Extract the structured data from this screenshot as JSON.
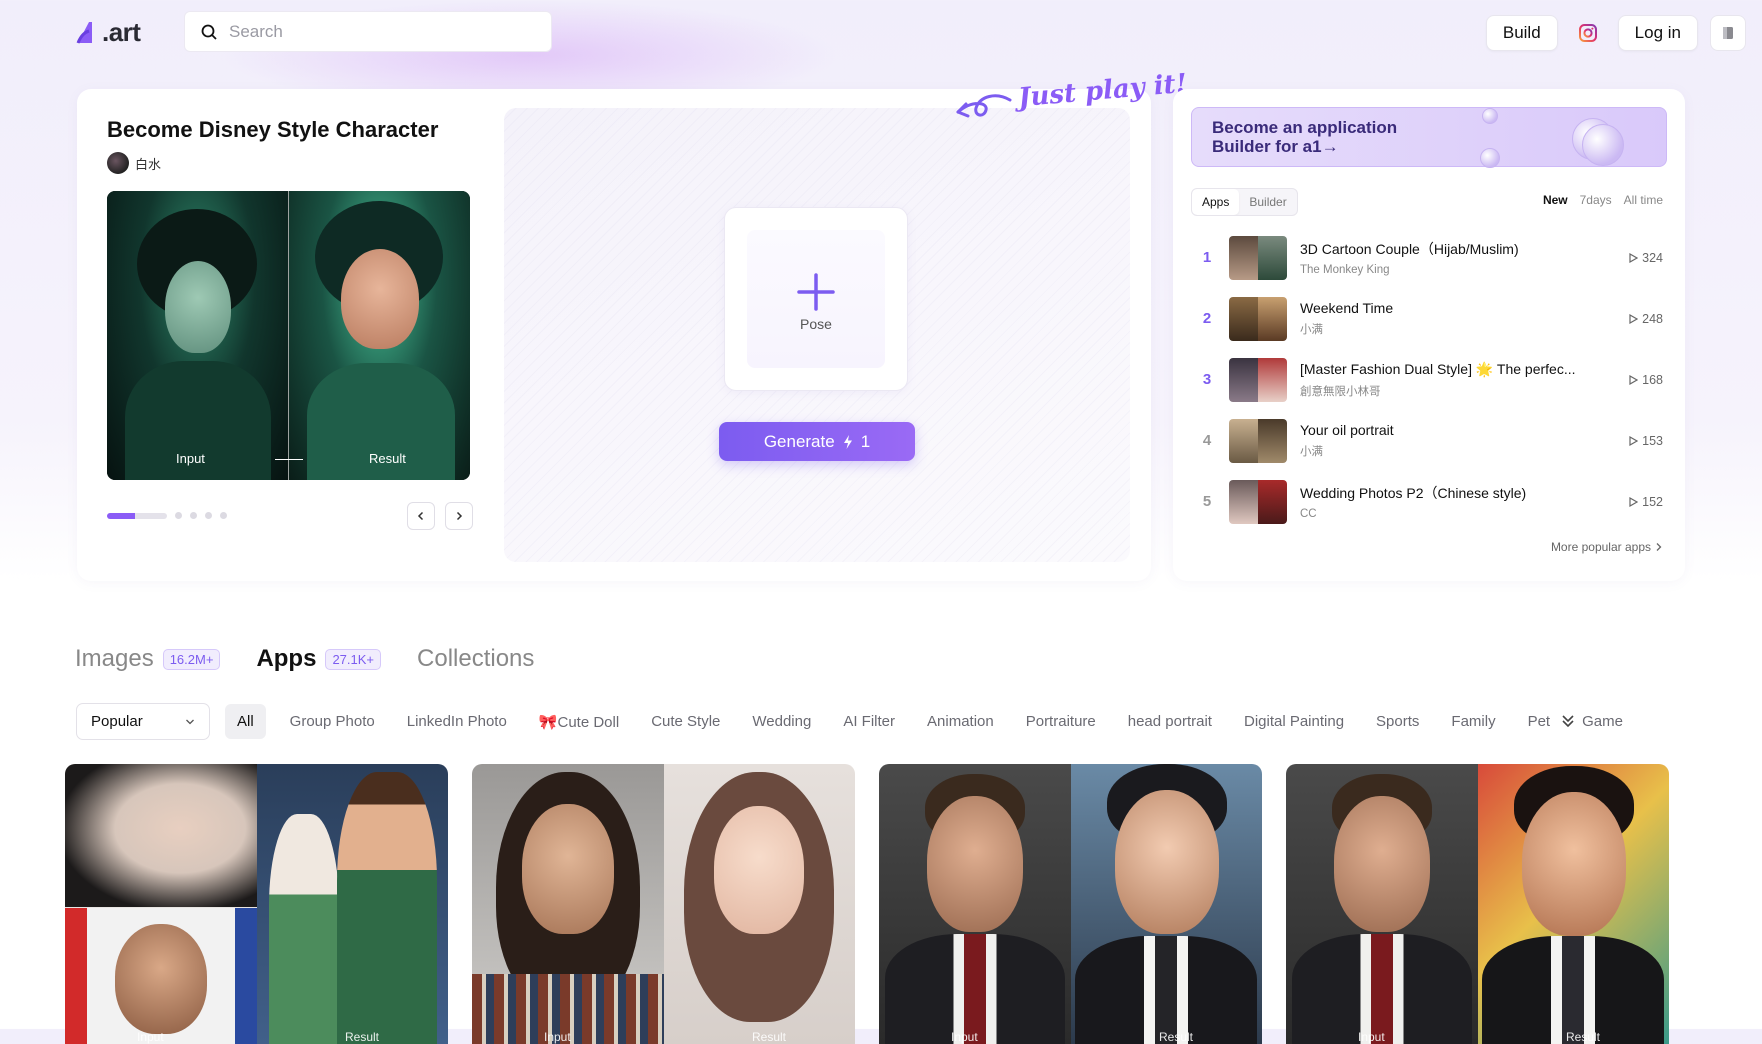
{
  "logo": {
    "text": ".art"
  },
  "search": {
    "placeholder": "Search"
  },
  "header": {
    "build_label": "Build",
    "login_label": "Log in",
    "instagram_icon": "instagram-icon",
    "theme_icon": "book-icon"
  },
  "featured": {
    "title": "Become Disney Style Character",
    "author": "白水",
    "input_label": "Input",
    "result_label": "Result",
    "carousel_total": 6,
    "carousel_index": 1,
    "pose_label": "Pose",
    "generate_label": "Generate",
    "generate_cost": "1",
    "tagline": "Just play it!"
  },
  "sidebar": {
    "banner_text": "Become an application Builder for a1→",
    "segments": [
      "Apps",
      "Builder"
    ],
    "active_segment": "Apps",
    "periods": [
      "New",
      "7days",
      "All time"
    ],
    "active_period": "New",
    "ranking": [
      {
        "rank": "1",
        "title": "3D Cartoon Couple（Hijab/Muslim)",
        "author": "The Monkey King",
        "count": "324"
      },
      {
        "rank": "2",
        "title": "Weekend Time",
        "author": "小满",
        "count": "248"
      },
      {
        "rank": "3",
        "title": "[Master Fashion Dual Style] 🌟 The perfec...",
        "author": "創意無限小林哥",
        "count": "168"
      },
      {
        "rank": "4",
        "title": "Your oil portrait",
        "author": "小满",
        "count": "153"
      },
      {
        "rank": "5",
        "title": "Wedding Photos P2（Chinese style)",
        "author": "CC",
        "count": "152"
      }
    ],
    "more_label": "More popular apps"
  },
  "tabs": [
    {
      "label": "Images",
      "badge": "16.2M+"
    },
    {
      "label": "Apps",
      "badge": "27.1K+"
    },
    {
      "label": "Collections",
      "badge": ""
    }
  ],
  "active_tab": "Apps",
  "sort": {
    "selected": "Popular"
  },
  "categories": [
    "All",
    "Group Photo",
    "LinkedIn Photo",
    "🎀Cute Doll",
    "Cute Style",
    "Wedding",
    "AI Filter",
    "Animation",
    "Portraiture",
    "head portrait",
    "Digital Painting",
    "Sports",
    "Family",
    "Pet",
    "Game"
  ],
  "active_category": "All",
  "grid_cards": [
    {
      "input_label": "Input",
      "result_label": "Result"
    },
    {
      "input_label": "Input",
      "result_label": "Result"
    },
    {
      "input_label": "Input",
      "result_label": "Result"
    },
    {
      "input_label": "Input",
      "result_label": "Result"
    }
  ],
  "colors": {
    "accent": "#8b5cf6",
    "banner": "#e6dcfb",
    "rank_accent": "#7c5cf0"
  }
}
